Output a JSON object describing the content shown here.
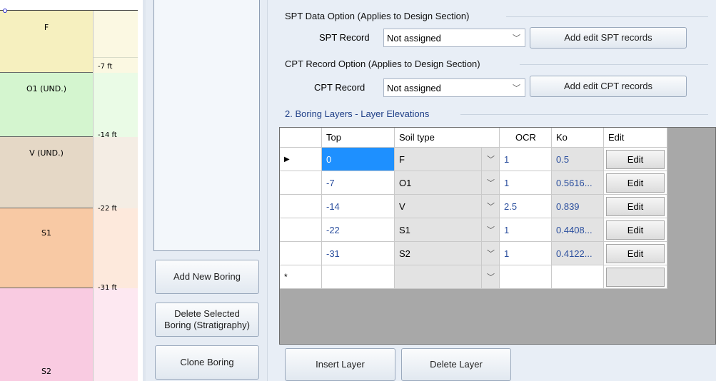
{
  "stratigraphy": {
    "layers": [
      {
        "label": "F",
        "color": "#f6f0bf",
        "ext_color": "#fbf8e2"
      },
      {
        "label": "O1 (UND.)",
        "color": "#d4f5cf",
        "ext_color": "#eafbe6"
      },
      {
        "label": "V (UND.)",
        "color": "#e5d8c6",
        "ext_color": "#f4ede4"
      },
      {
        "label": "S1",
        "color": "#f8c9a4",
        "ext_color": "#fde9dc"
      },
      {
        "label": "S2",
        "color": "#f9cbe1",
        "ext_color": "#fde8f1"
      }
    ],
    "elevations": [
      "-7 ft",
      "-14 ft",
      "-22 ft",
      "-31 ft"
    ]
  },
  "boring_buttons": {
    "add": "Add New Boring",
    "delete_line1": "Delete Selected",
    "delete_line2": "Boring (Stratigraphy)",
    "clone": "Clone Boring"
  },
  "spt": {
    "group_title": "SPT Data Option (Applies to Design Section)",
    "label": "SPT Record",
    "value": "Not assigned",
    "button": "Add edit SPT records"
  },
  "cpt": {
    "group_title": "CPT Record Option (Applies to Design Section)",
    "label": "CPT Record",
    "value": "Not assigned",
    "button": "Add edit CPT records"
  },
  "layers_group": {
    "title": "2. Boring Layers - Layer Elevations"
  },
  "grid": {
    "columns": [
      "Top",
      "Soil type",
      "OCR",
      "Ko",
      "Edit"
    ],
    "rows": [
      {
        "top": "0",
        "soil": "F",
        "ocr": "1",
        "ko": "0.5",
        "edit": "Edit"
      },
      {
        "top": "-7",
        "soil": "O1",
        "ocr": "1",
        "ko": "0.5616...",
        "edit": "Edit"
      },
      {
        "top": "-14",
        "soil": "V",
        "ocr": "2.5",
        "ko": "0.839",
        "edit": "Edit"
      },
      {
        "top": "-22",
        "soil": "S1",
        "ocr": "1",
        "ko": "0.4408...",
        "edit": "Edit"
      },
      {
        "top": "-31",
        "soil": "S2",
        "ocr": "1",
        "ko": "0.4122...",
        "edit": "Edit"
      }
    ],
    "current_row_marker": "▶",
    "new_row_marker": "*",
    "value_color": "#2b4f9e"
  },
  "layer_buttons": {
    "insert": "Insert Layer",
    "delete": "Delete Layer"
  }
}
